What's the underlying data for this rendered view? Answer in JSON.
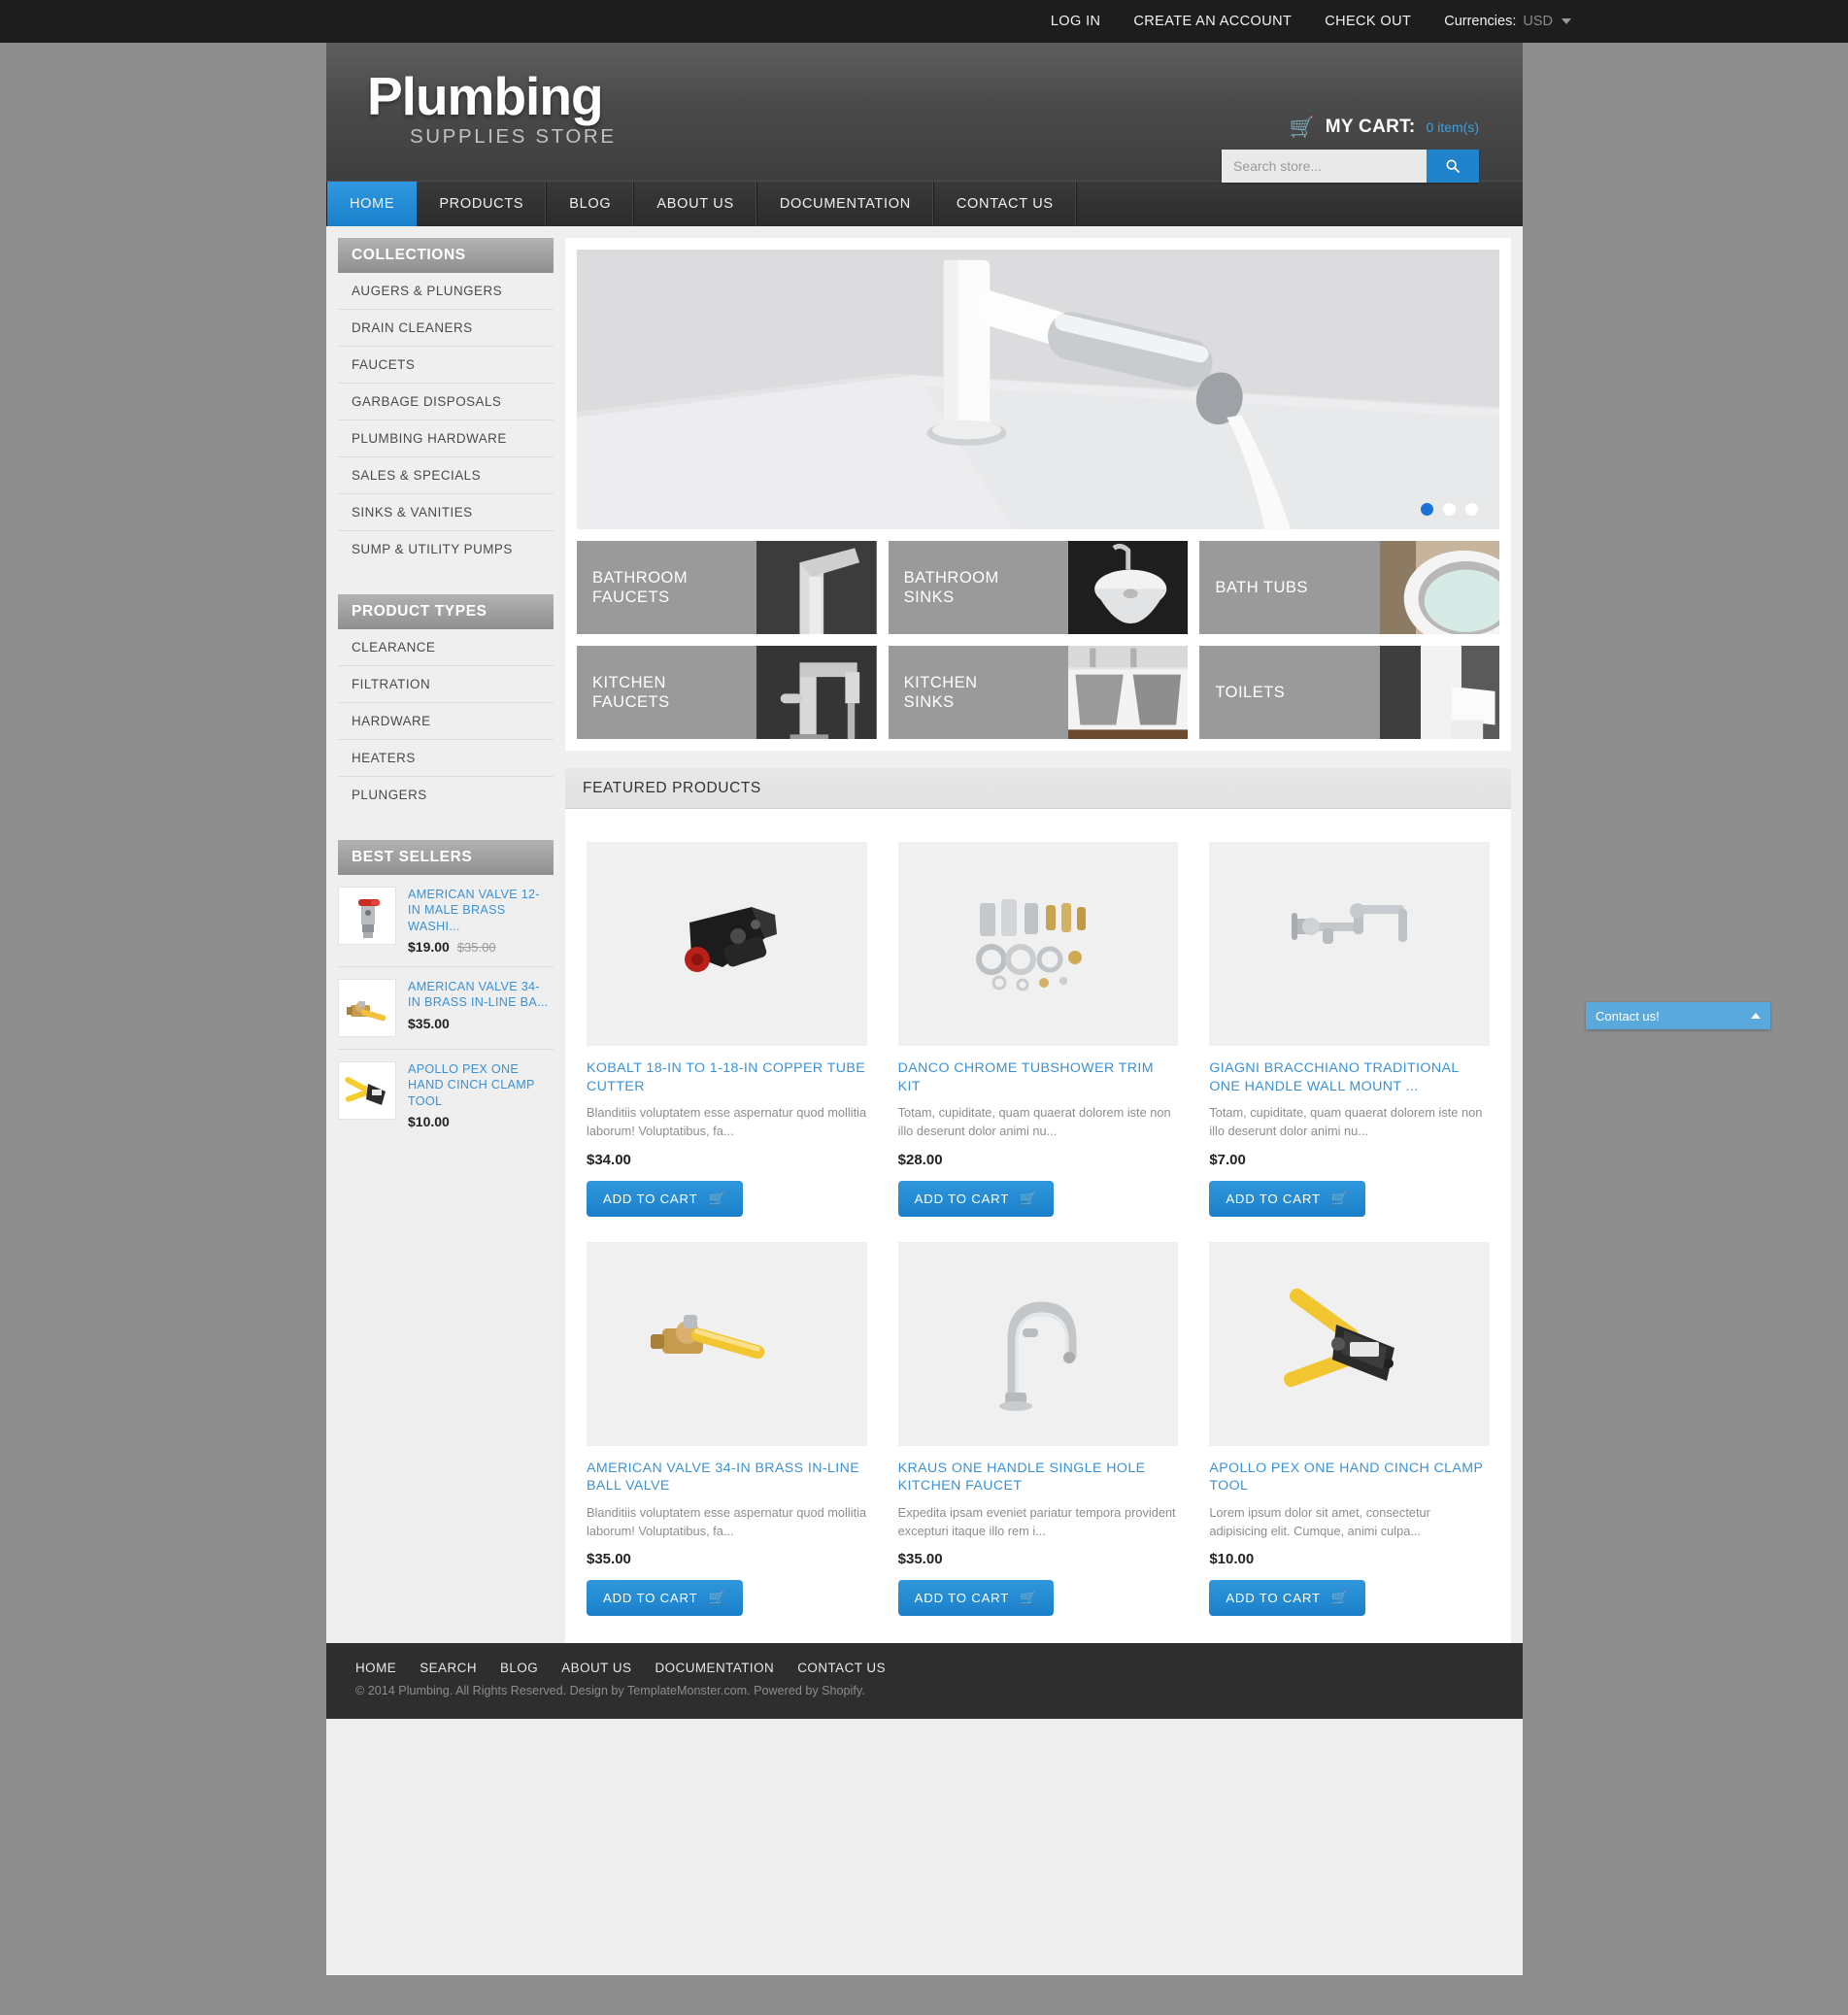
{
  "topbar": {
    "links": [
      {
        "label": "LOG IN",
        "name": "log-in-link"
      },
      {
        "label": "CREATE AN ACCOUNT",
        "name": "create-account-link"
      },
      {
        "label": "CHECK OUT",
        "name": "check-out-link"
      }
    ],
    "currency_label": "Currencies:",
    "currency_value": "USD"
  },
  "header": {
    "logo_main": "Plumbing",
    "logo_sub": "SUPPLIES STORE",
    "cart_label": "MY CART:",
    "cart_count": "0 item(s)",
    "search_placeholder": "Search store...",
    "search_value": ""
  },
  "nav": {
    "items": [
      {
        "label": "HOME",
        "active": true
      },
      {
        "label": "PRODUCTS",
        "active": false
      },
      {
        "label": "BLOG",
        "active": false
      },
      {
        "label": "ABOUT US",
        "active": false
      },
      {
        "label": "DOCUMENTATION",
        "active": false
      },
      {
        "label": "CONTACT US",
        "active": false
      }
    ]
  },
  "sidebar": {
    "collections": {
      "title": "COLLECTIONS",
      "items": [
        "AUGERS & PLUNGERS",
        "DRAIN CLEANERS",
        "FAUCETS",
        "GARBAGE DISPOSALS",
        "PLUMBING HARDWARE",
        "SALES & SPECIALS",
        "SINKS & VANITIES",
        "SUMP & UTILITY PUMPS"
      ]
    },
    "product_types": {
      "title": "PRODUCT TYPES",
      "items": [
        "CLEARANCE",
        "FILTRATION",
        "HARDWARE",
        "HEATERS",
        "PLUNGERS"
      ]
    },
    "best_sellers": {
      "title": "BEST SELLERS",
      "items": [
        {
          "title": "AMERICAN VALVE 12-IN MALE BRASS WASHI...",
          "price": "$19.00",
          "old_price": "$35.00",
          "thumb": "red-handle-valve"
        },
        {
          "title": "AMERICAN VALVE 34-IN BRASS IN-LINE BA...",
          "price": "$35.00",
          "old_price": "",
          "thumb": "brass-ball-valve"
        },
        {
          "title": "APOLLO PEX ONE HAND CINCH CLAMP TOOL",
          "price": "$10.00",
          "old_price": "",
          "thumb": "yellow-cinch-tool"
        }
      ]
    }
  },
  "slider": {
    "image_alt": "white-faucet-running-water-over-sink",
    "dots": [
      {
        "active": true
      },
      {
        "active": false
      },
      {
        "active": false
      }
    ]
  },
  "category_tiles": [
    {
      "line1": "BATHROOM",
      "line2": "FAUCETS",
      "image_alt": "bathroom-faucet-photo"
    },
    {
      "line1": "BATHROOM",
      "line2": "SINKS",
      "image_alt": "bathroom-sink-photo"
    },
    {
      "line1": "BATH TUBS",
      "line2": "",
      "image_alt": "bath-tub-photo"
    },
    {
      "line1": "KITCHEN",
      "line2": "FAUCETS",
      "image_alt": "kitchen-faucet-photo"
    },
    {
      "line1": "KITCHEN",
      "line2": "SINKS",
      "image_alt": "kitchen-sink-photo"
    },
    {
      "line1": "TOILETS",
      "line2": "",
      "image_alt": "toilet-photo"
    }
  ],
  "featured": {
    "title": "FEATURED PRODUCTS",
    "add_to_cart_label": "ADD TO CART",
    "products": [
      {
        "title": "KOBALT 18-IN TO 1-18-IN COPPER TUBE CUTTER",
        "desc": "Blanditiis voluptatem esse aspernatur quod mollitia laborum! Voluptatibus, fa...",
        "price": "$34.00",
        "image_alt": "black-copper-tube-cutter"
      },
      {
        "title": "DANCO CHROME TUBSHOWER TRIM KIT",
        "desc": "Totam, cupiditate, quam quaerat dolorem iste non illo deserunt dolor animi nu...",
        "price": "$28.00",
        "image_alt": "chrome-trim-kit-parts"
      },
      {
        "title": "GIAGNI BRACCHIANO TRADITIONAL ONE HANDLE WALL MOUNT ...",
        "desc": "Totam, cupiditate, quam quaerat dolorem iste non illo deserunt dolor animi nu...",
        "price": "$7.00",
        "image_alt": "wall-mount-pot-filler-faucet"
      },
      {
        "title": "AMERICAN VALVE 34-IN BRASS IN-LINE BALL VALVE",
        "desc": "Blanditiis voluptatem esse aspernatur quod mollitia laborum! Voluptatibus, fa...",
        "price": "$35.00",
        "image_alt": "brass-ball-valve-yellow-handle"
      },
      {
        "title": "KRAUS ONE HANDLE SINGLE HOLE KITCHEN FAUCET",
        "desc": "Expedita ipsam eveniet pariatur tempora provident excepturi itaque illo rem i...",
        "price": "$35.00",
        "image_alt": "chrome-gooseneck-kitchen-faucet"
      },
      {
        "title": "APOLLO PEX ONE HAND CINCH CLAMP TOOL",
        "desc": "Lorem ipsum dolor sit amet, consectetur adipisicing elit. Cumque, animi culpa...",
        "price": "$10.00",
        "image_alt": "yellow-cinch-clamp-tool"
      }
    ]
  },
  "footer": {
    "links": [
      "HOME",
      "SEARCH",
      "BLOG",
      "ABOUT US",
      "DOCUMENTATION",
      "CONTACT US"
    ],
    "copyright": "© 2014 Plumbing. All Rights Reserved. Design by TemplateMonster.com. Powered by Shopify."
  },
  "contact_widget": {
    "label": "Contact us!"
  },
  "colors": {
    "accent_blue": "#1f84cc",
    "link_blue": "#3b91d6",
    "page_bg": "#8e8e8e",
    "panel_bg": "#efefef",
    "footer_bg": "#2e2e2e",
    "topbar_bg": "#1d1d1d"
  }
}
